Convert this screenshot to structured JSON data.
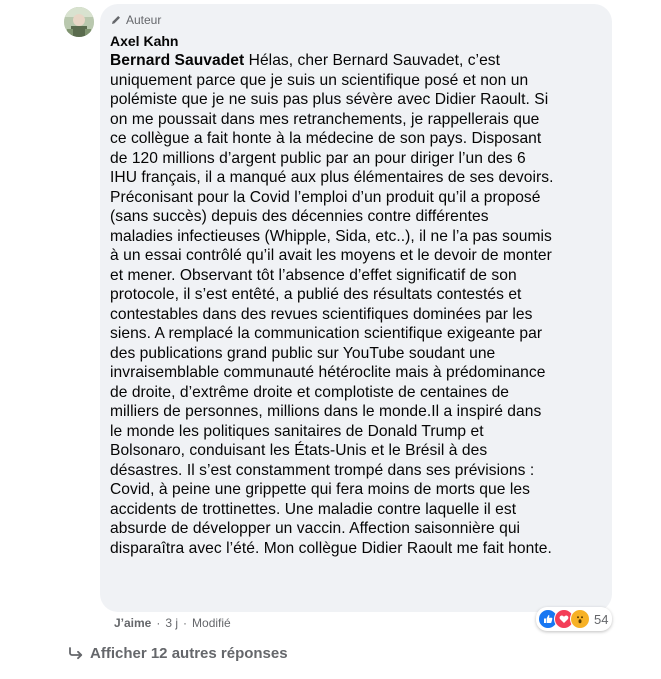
{
  "comment": {
    "badge_label": "Auteur",
    "author_name": "Axel Kahn",
    "mention": "Bernard Sauvadet",
    "lines": [
      " Hélas, cher Bernard Sauvadet, c’est",
      "uniquement parce que je suis un scientifique posé et non un",
      "polémiste que je ne suis pas plus sévère avec Didier Raoult. Si",
      "on me poussait dans mes retranchements, je rappellerais que",
      "ce collègue a fait honte à la médecine de son pays. Disposant",
      "de 120 millions d’argent public par an pour diriger l’un des 6",
      "IHU français, il a manqué aux plus élémentaires de ses devoirs.",
      "Préconisant pour la Covid l’emploi d’un produit qu’il a proposé",
      "(sans succès) depuis des décennies contre différentes",
      "maladies infectieuses (Whipple, Sida, etc..), il ne l’a pas soumis",
      "à un essai contrôlé qu’il avait les moyens et le devoir de monter",
      "et mener. Observant tôt l’absence d’effet significatif de son",
      "protocole, il s’est entêté, a publié des résultats contestés et",
      "contestables dans des revues scientifiques dominées par les",
      "siens. A remplacé la communication scientifique exigeante par",
      "des publications grand public sur YouTube soudant une",
      "invraisemblable communauté hétéroclite mais à prédominance",
      "de droite, d’extrême droite et complotiste de centaines de",
      "milliers de personnes, millions dans le monde.Il a inspiré dans",
      "le monde les politiques sanitaires de Donald Trump et",
      "Bolsonaro, conduisant les États-Unis et le Brésil à des",
      "désastres. Il s’est constamment trompé dans ses prévisions :",
      "Covid, à peine une grippette qui fera moins de morts que les",
      "accidents de trottinettes. Une maladie contre laquelle il est",
      "absurde de développer un vaccin. Affection saisonnière qui",
      "disparaîtra avec l’été. Mon collègue Didier Raoult me fait honte."
    ]
  },
  "actions": {
    "like": "J’aime",
    "sep1": "·",
    "time": "3 j",
    "sep2": "·",
    "edited": "Modifié"
  },
  "reactions": {
    "icons": [
      "like-icon",
      "love-icon",
      "wow-icon"
    ],
    "count": "54"
  },
  "more_replies": "Afficher 12 autres réponses",
  "colors": {
    "bubble": "#f0f2f5",
    "secondary_text": "#65676b",
    "like_blue": "#1877f2",
    "love_red": "#f33e58",
    "wow_yellow": "#f7b125"
  }
}
